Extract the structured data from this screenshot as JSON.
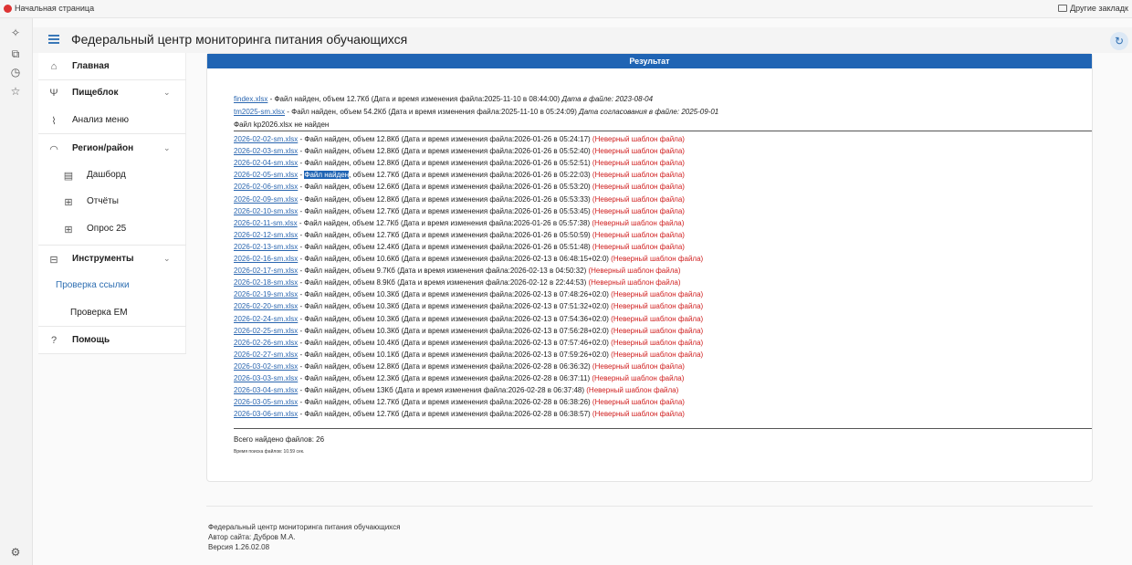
{
  "bookmarks": {
    "home": "Начальная страница",
    "other": "Другие закладк"
  },
  "header": {
    "title": "Федеральный центр мониторинга питания обучающихся"
  },
  "sidebar": {
    "items": [
      {
        "label": "Главная"
      },
      {
        "label": "Пищеблок"
      },
      {
        "label": "Анализ меню"
      },
      {
        "label": "Регион/район"
      },
      {
        "label": "Дашборд"
      },
      {
        "label": "Отчёты"
      },
      {
        "label": "Опрос 25"
      },
      {
        "label": "Инструменты"
      },
      {
        "label": "Проверка ссылки"
      },
      {
        "label": "Проверка ЕМ"
      },
      {
        "label": "Помощь"
      }
    ]
  },
  "result": {
    "title": "Результат",
    "top_lines": [
      {
        "link": "findex.xlsx",
        "text": " - Файл найден, объем 12.7Кб (Дата и время изменения файла:2025-11-10 в 08:44:00) ",
        "italic": "Дата в файле: 2023-08-04"
      },
      {
        "link": "tm2025-sm.xlsx",
        "text": " - Файл найден, объем 54.2Кб (Дата и время изменения файла:2025-11-10 в 05:24:09) ",
        "italic": "Дата согласования в файле: 2025-09-01"
      }
    ],
    "not_found": "Файл kp2026.xlsx не найден",
    "found_text": "Файл найден",
    "error_text": "(Неверный шаблон файла)",
    "files": [
      {
        "name": "2026-02-02-sm.xlsx",
        "info": ", объем 12.8Кб (Дата и время изменения файла:2026-01-26 в 05:24:17) "
      },
      {
        "name": "2026-02-03-sm.xlsx",
        "info": ", объем 12.8Кб (Дата и время изменения файла:2026-01-26 в 05:52:40) "
      },
      {
        "name": "2026-02-04-sm.xlsx",
        "info": ", объем 12.8Кб (Дата и время изменения файла:2026-01-26 в 05:52:51) "
      },
      {
        "name": "2026-02-05-sm.xlsx",
        "info": ", объем 12.7Кб (Дата и время изменения файла:2026-01-26 в 05:22:03) "
      },
      {
        "name": "2026-02-06-sm.xlsx",
        "info": ", объем 12.6Кб (Дата и время изменения файла:2026-01-26 в 05:53:20) "
      },
      {
        "name": "2026-02-09-sm.xlsx",
        "info": ", объем 12.8Кб (Дата и время изменения файла:2026-01-26 в 05:53:33) "
      },
      {
        "name": "2026-02-10-sm.xlsx",
        "info": ", объем 12.7Кб (Дата и время изменения файла:2026-01-26 в 05:53:45) "
      },
      {
        "name": "2026-02-11-sm.xlsx",
        "info": ", объем 12.7Кб (Дата и время изменения файла:2026-01-26 в 05:57:38) "
      },
      {
        "name": "2026-02-12-sm.xlsx",
        "info": ", объем 12.7Кб (Дата и время изменения файла:2026-01-26 в 05:50:59) "
      },
      {
        "name": "2026-02-13-sm.xlsx",
        "info": ", объем 12.4Кб (Дата и время изменения файла:2026-01-26 в 05:51:48) "
      },
      {
        "name": "2026-02-16-sm.xlsx",
        "info": ", объем 10.6Кб (Дата и время изменения файла:2026-02-13 в 06:48:15+02:0) "
      },
      {
        "name": "2026-02-17-sm.xlsx",
        "info": ", объем 9.7Кб (Дата и время изменения файла:2026-02-13 в 04:50:32) "
      },
      {
        "name": "2026-02-18-sm.xlsx",
        "info": ", объем 8.9Кб (Дата и время изменения файла:2026-02-12 в 22:44:53) "
      },
      {
        "name": "2026-02-19-sm.xlsx",
        "info": ", объем 10.3Кб (Дата и время изменения файла:2026-02-13 в 07:48:26+02:0) "
      },
      {
        "name": "2026-02-20-sm.xlsx",
        "info": ", объем 10.3Кб (Дата и время изменения файла:2026-02-13 в 07:51:32+02:0) "
      },
      {
        "name": "2026-02-24-sm.xlsx",
        "info": ", объем 10.3Кб (Дата и время изменения файла:2026-02-13 в 07:54:36+02:0) "
      },
      {
        "name": "2026-02-25-sm.xlsx",
        "info": ", объем 10.3Кб (Дата и время изменения файла:2026-02-13 в 07:56:28+02:0) "
      },
      {
        "name": "2026-02-26-sm.xlsx",
        "info": ", объем 10.4Кб (Дата и время изменения файла:2026-02-13 в 07:57:46+02:0) "
      },
      {
        "name": "2026-02-27-sm.xlsx",
        "info": ", объем 10.1Кб (Дата и время изменения файла:2026-02-13 в 07:59:26+02:0) "
      },
      {
        "name": "2026-03-02-sm.xlsx",
        "info": ", объем 12.8Кб (Дата и время изменения файла:2026-02-28 в 06:36:32) "
      },
      {
        "name": "2026-03-03-sm.xlsx",
        "info": ", объем 12.3Кб (Дата и время изменения файла:2026-02-28 в 06:37:11) "
      },
      {
        "name": "2026-03-04-sm.xlsx",
        "info": ", объем 13Кб (Дата и время изменения файла:2026-02-28 в 06:37:48) "
      },
      {
        "name": "2026-03-05-sm.xlsx",
        "info": ", объем 12.7Кб (Дата и время изменения файла:2026-02-28 в 06:38:26) "
      },
      {
        "name": "2026-03-06-sm.xlsx",
        "info": ", объем 12.7Кб (Дата и время изменения файла:2026-02-28 в 06:38:57) "
      }
    ],
    "total": "Всего найдено файлов: 26",
    "time": "Время поиска файлов: 10.59 сек."
  },
  "footer": {
    "org": "Федеральный центр мониторинга питания обучающихся",
    "author": "Автор сайта: Дубров М.А.",
    "version": "Версия 1.26.02.08"
  },
  "colors": {
    "accent": "#1f64b4",
    "link": "#2a66b0",
    "error": "#d02020"
  }
}
